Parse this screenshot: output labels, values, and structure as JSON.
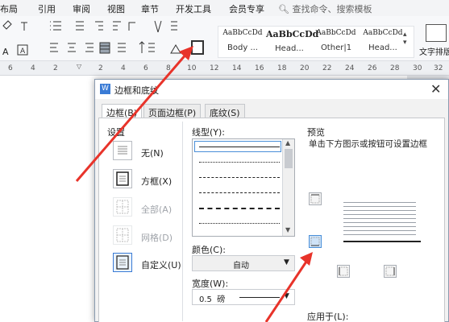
{
  "ribbon": {
    "menus": [
      "布局",
      "引用",
      "审阅",
      "视图",
      "章节",
      "开发工具",
      "会员专享"
    ],
    "search_placeholder": "查找命令、搜索模板",
    "styles": [
      {
        "sample": "AaBbCcDd",
        "name": "Body ..."
      },
      {
        "sample": "AaBbCcDd",
        "name": "Head..."
      },
      {
        "sample": "AaBbCcDd",
        "name": "Other|1"
      },
      {
        "sample": "AaBbCcDd",
        "name": "Head..."
      }
    ],
    "text_layout_label": "文字排版",
    "ruler_numbers": [
      "6",
      "4",
      "2",
      "2",
      "4",
      "6",
      "8",
      "10",
      "12",
      "14",
      "16",
      "18",
      "20",
      "22",
      "24",
      "26",
      "28",
      "30",
      "32"
    ]
  },
  "dialog": {
    "title": "边框和底纹",
    "close_label": "✕",
    "tabs": [
      "边框(B)",
      "页面边框(P)",
      "底纹(S)"
    ],
    "settings_title": "设置",
    "settings": [
      {
        "label": "无(N)",
        "disabled": false
      },
      {
        "label": "方框(X)",
        "disabled": false
      },
      {
        "label": "全部(A)",
        "disabled": true
      },
      {
        "label": "网格(D)",
        "disabled": true
      },
      {
        "label": "自定义(U)",
        "disabled": false
      }
    ],
    "line_style_label": "线型(Y):",
    "color_label": "颜色(C):",
    "color_value": "自动",
    "width_label": "宽度(W):",
    "width_value": "0.5  磅",
    "preview_title": "预览",
    "preview_hint": "单击下方图示或按钮可设置边框",
    "apply_label": "应用于(L):"
  },
  "colors": {
    "accent": "#3a7bd5",
    "arrow": "#e8332a"
  }
}
